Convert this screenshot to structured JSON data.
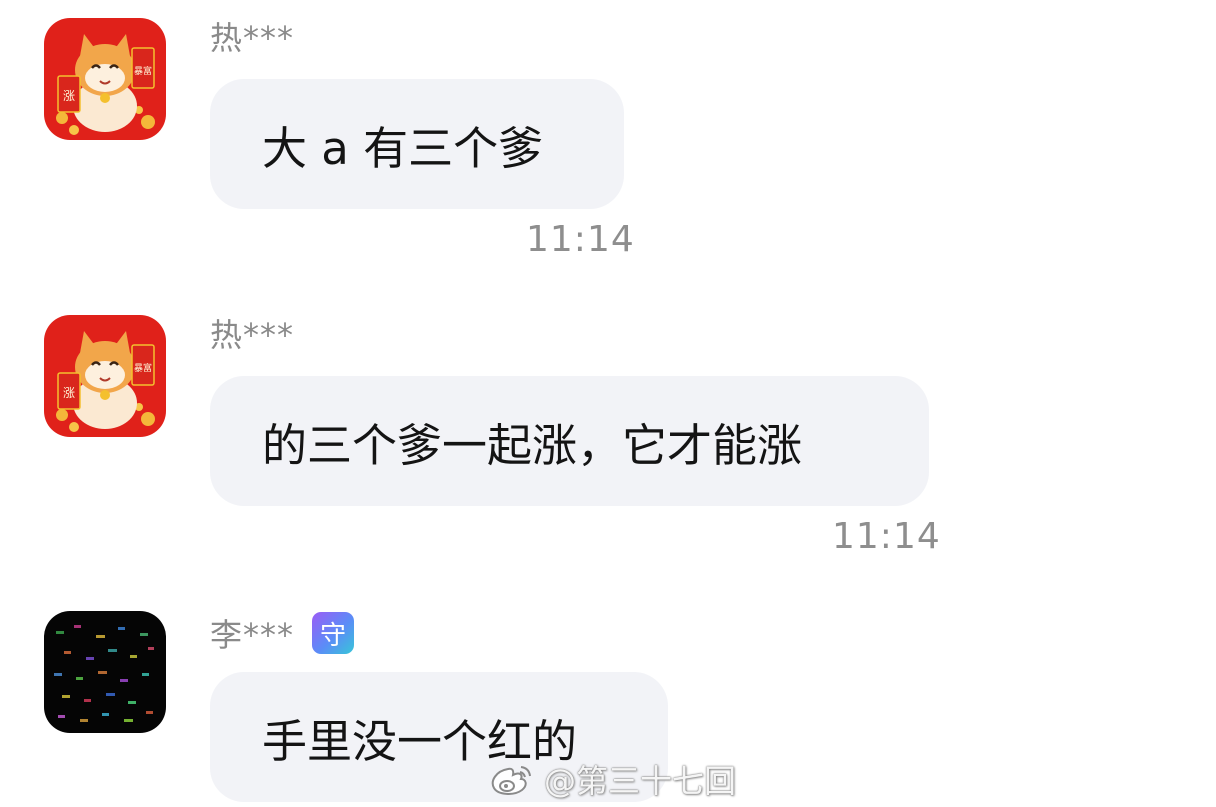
{
  "messages": [
    {
      "sender": "热***",
      "text": "大 a 有三个爹",
      "time": "11:14",
      "avatar": "lucky-cat-icon",
      "badge": ""
    },
    {
      "sender": "热***",
      "text": "的三个爹一起涨，它才能涨",
      "time": "11:14",
      "avatar": "lucky-cat-icon",
      "badge": ""
    },
    {
      "sender": "李***",
      "text": "手里没一个红的",
      "time": "",
      "avatar": "dark-mosaic-avatar",
      "badge": "守"
    }
  ],
  "avatar_text": {
    "left": "涨",
    "right": "暴富"
  },
  "watermark": {
    "text": "@第三十七回",
    "icon": "weibo-icon"
  },
  "colors": {
    "bubble": "#f2f3f7",
    "sender": "#8a8a8a",
    "time": "#8e8e8e",
    "avatar_red": "#e0211a"
  }
}
